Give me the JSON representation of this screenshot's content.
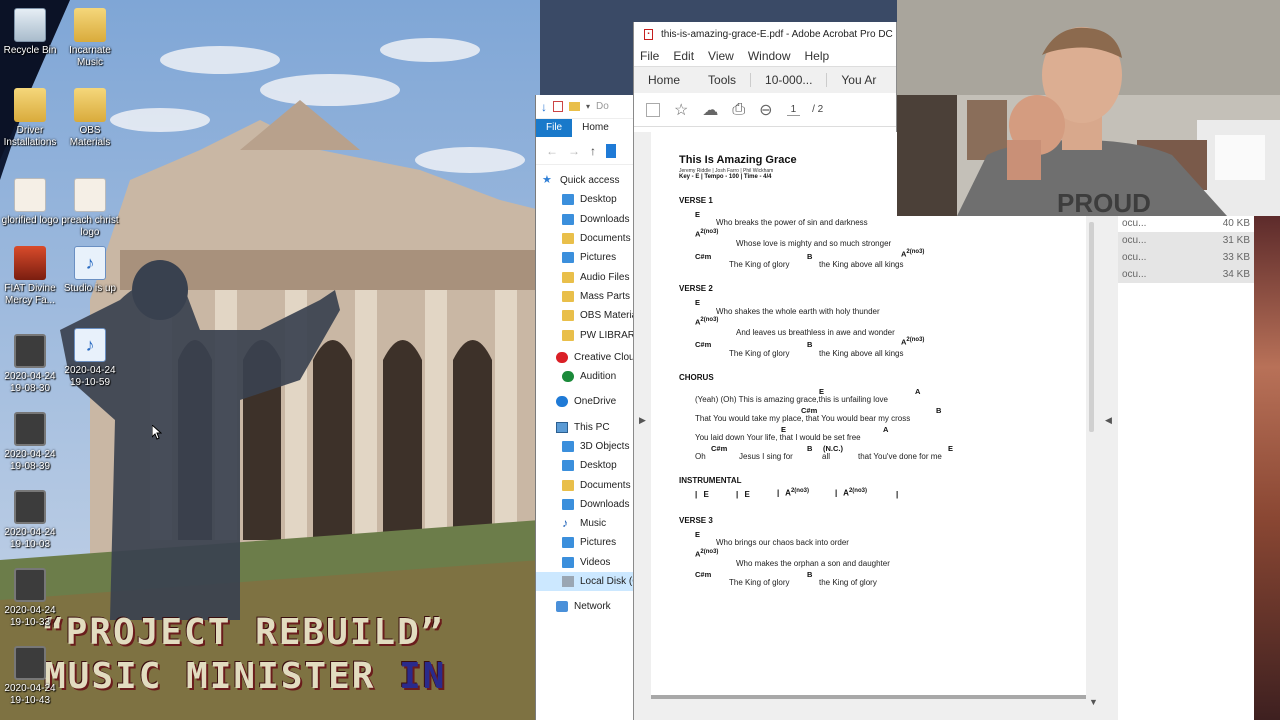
{
  "desktop": {
    "icons": [
      {
        "label": "Recycle Bin"
      },
      {
        "label": "Incarnate Music"
      },
      {
        "label": "Driver Installations"
      },
      {
        "label": "OBS Materials"
      },
      {
        "label": "glorified logo"
      },
      {
        "label": "preach christ logo"
      },
      {
        "label": "FIAT Divine Mercy Fa..."
      },
      {
        "label": "Studio is up"
      },
      {
        "label": "2020-04-24 19-08-30"
      },
      {
        "label": "2020-04-24 19-10-59"
      },
      {
        "label": "2020-04-24 19-08-39"
      },
      {
        "label": "2020-04-24 19-10-03"
      },
      {
        "label": "2020-04-24 19-10-33"
      },
      {
        "label": "2020-04-24 19-10-43"
      }
    ],
    "banner_line1": "“PROJECT REBUILD”",
    "banner_line2_a": "MUSIC MINISTER ",
    "banner_line2_b": "IN"
  },
  "explorer": {
    "toolbar_partial": "Do",
    "ribbon": {
      "file": "File",
      "home": "Home"
    },
    "nav": [
      {
        "label": "Quick access",
        "icon": "star-icon"
      },
      {
        "label": "Desktop",
        "icon": "desktop-icon"
      },
      {
        "label": "Downloads",
        "icon": "download-icon"
      },
      {
        "label": "Documents",
        "icon": "documents-icon"
      },
      {
        "label": "Pictures",
        "icon": "pictures-icon"
      },
      {
        "label": "Audio Files",
        "icon": "folder-icon"
      },
      {
        "label": "Mass Parts",
        "icon": "folder-icon"
      },
      {
        "label": "OBS Material",
        "icon": "folder-icon"
      },
      {
        "label": "PW LIBRARY",
        "icon": "folder-icon"
      },
      {
        "label": "Creative Cloud",
        "icon": "creative-cloud-icon"
      },
      {
        "label": "Audition",
        "icon": "audition-icon"
      },
      {
        "label": "OneDrive",
        "icon": "onedrive-icon"
      },
      {
        "label": "This PC",
        "icon": "pc-icon"
      },
      {
        "label": "3D Objects",
        "icon": "3d-objects-icon"
      },
      {
        "label": "Desktop",
        "icon": "desktop-icon"
      },
      {
        "label": "Documents",
        "icon": "documents-icon"
      },
      {
        "label": "Downloads",
        "icon": "download-icon"
      },
      {
        "label": "Music",
        "icon": "music-icon"
      },
      {
        "label": "Pictures",
        "icon": "pictures-icon"
      },
      {
        "label": "Videos",
        "icon": "videos-icon"
      },
      {
        "label": "Local Disk (C:",
        "icon": "disk-icon"
      },
      {
        "label": "Network",
        "icon": "network-icon"
      }
    ]
  },
  "acrobat": {
    "title": "this-is-amazing-grace-E.pdf - Adobe Acrobat Pro DC",
    "menu": [
      "File",
      "Edit",
      "View",
      "Window",
      "Help"
    ],
    "tabs": [
      "Home",
      "Tools",
      "10-000...",
      "You Ar"
    ],
    "page_current": "1",
    "page_total": "/ 2"
  },
  "song": {
    "title": "This Is Amazing Grace",
    "authors": "Jeremy Riddle | Josh Farro | Phil Wickham",
    "meta": "Key - E | Tempo - 100 | Time - 4/4",
    "verse1": {
      "heading": "VERSE 1",
      "c1": "E",
      "l1": "Who breaks the power of sin and darkness",
      "c2": "A",
      "c2sup": "2(no3)",
      "l2": "Whose love is mighty and so much stronger",
      "c3a": "C#m",
      "c3b": "B",
      "c3c": "A",
      "c3csup": "2(no3)",
      "l3a": "The King of glory",
      "l3b": "the King above all kings"
    },
    "verse2": {
      "heading": "VERSE 2",
      "c1": "E",
      "l1": "Who shakes the whole earth with holy thunder",
      "c2": "A",
      "c2sup": "2(no3)",
      "l2": "And leaves us breathless in awe and wonder",
      "c3a": "C#m",
      "c3b": "B",
      "c3c": "A",
      "c3csup": "2(no3)",
      "l3a": "The King of glory",
      "l3b": "the King above all kings"
    },
    "chorus": {
      "heading": "CHORUS",
      "ch1a": "E",
      "ch1b": "A",
      "l1": "(Yeah) (Oh) This is amazing grace,this is unfailing love",
      "ch2a": "C#m",
      "ch2b": "B",
      "l2": "That You would take my place, that You would bear my cross",
      "ch3a": "E",
      "ch3b": "A",
      "l3": "You laid down Your life, that I would be set free",
      "ch4a": "C#m",
      "ch4b": "B",
      "ch4c": "(N.C.)",
      "ch4d": "E",
      "l4a": "Oh",
      "l4b": "Jesus I sing for",
      "l4c": "all",
      "l4d": "that You've done for me"
    },
    "instrumental": {
      "heading": "INSTRUMENTAL",
      "p1": "| E",
      "p2": "| E",
      "p3": "| A",
      "p3sup": "2(no3)",
      "p4": "| A",
      "p4sup": "2(no3)",
      "p5": "|"
    },
    "verse3": {
      "heading": "VERSE 3",
      "c1": "E",
      "l1": "Who brings our chaos back into order",
      "c2": "A",
      "c2sup": "2(no3)",
      "l2": "Who makes the orphan a son and daughter",
      "c3a": "C#m",
      "c3b": "B",
      "l3a": "The King of glory",
      "l3b": "the King of glory"
    }
  },
  "file_list": [
    {
      "name": "ocu...",
      "size": "40 KB"
    },
    {
      "name": "ocu...",
      "size": "31 KB"
    },
    {
      "name": "ocu...",
      "size": "33 KB"
    },
    {
      "name": "ocu...",
      "size": "34 KB"
    }
  ],
  "webcam": {
    "shirt_text": "PROUD"
  }
}
